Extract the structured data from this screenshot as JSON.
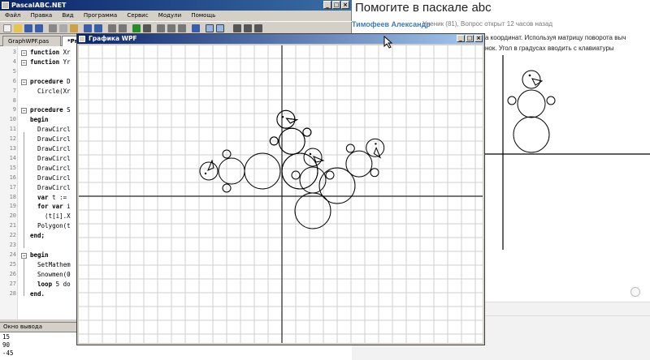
{
  "ide": {
    "title": "PascalABC.NET",
    "menu": [
      "Файл",
      "Правка",
      "Вид",
      "Программа",
      "Сервис",
      "Модули",
      "Помощь"
    ],
    "tabs": [
      {
        "label": "GraphWPF.pas",
        "active": false
      },
      {
        "label": "*Pr",
        "active": true
      }
    ],
    "code_lines": [
      {
        "n": "3",
        "text": "function Xr"
      },
      {
        "n": "4",
        "text": "function Yr"
      },
      {
        "n": "5",
        "text": ""
      },
      {
        "n": "6",
        "text": "procedure D"
      },
      {
        "n": "7",
        "text": "  Circle(Xr"
      },
      {
        "n": "8",
        "text": ""
      },
      {
        "n": "9",
        "text": "procedure S"
      },
      {
        "n": "10",
        "text": "begin"
      },
      {
        "n": "11",
        "text": "  DrawCircl"
      },
      {
        "n": "12",
        "text": "  DrawCircl"
      },
      {
        "n": "13",
        "text": "  DrawCircl"
      },
      {
        "n": "14",
        "text": "  DrawCircl"
      },
      {
        "n": "15",
        "text": "  DrawCircl"
      },
      {
        "n": "16",
        "text": "  DrawCircl"
      },
      {
        "n": "17",
        "text": "  DrawCircl"
      },
      {
        "n": "18",
        "text": "  var t :="
      },
      {
        "n": "19",
        "text": "  for var i"
      },
      {
        "n": "20",
        "text": "    (t[i].X"
      },
      {
        "n": "21",
        "text": "  Polygon(t"
      },
      {
        "n": "22",
        "text": "end;"
      },
      {
        "n": "23",
        "text": ""
      },
      {
        "n": "24",
        "text": "begin"
      },
      {
        "n": "25",
        "text": "  SetMathem"
      },
      {
        "n": "26",
        "text": "  Snowmen(0"
      },
      {
        "n": "27",
        "text": "  loop 5 do"
      },
      {
        "n": "28",
        "text": "end."
      }
    ],
    "output_header": "Окно вывода",
    "output_lines": [
      "15",
      "90",
      "-45"
    ]
  },
  "wpf": {
    "title": "Графика WPF"
  },
  "page": {
    "title": "Помогите в паскале abc",
    "author": "Тимофеев Александр",
    "meta": "Ученик (81), Вопрос открыт 12 часов назад",
    "text_line1": "а координат. Используя матрицу поворота выч",
    "text_line2": "нок. Угол в градусах вводить с клавиатуры"
  },
  "colors": {
    "titlebar": "#0a246a",
    "link": "#3b7bbf",
    "grid": "#cfcfcf"
  }
}
